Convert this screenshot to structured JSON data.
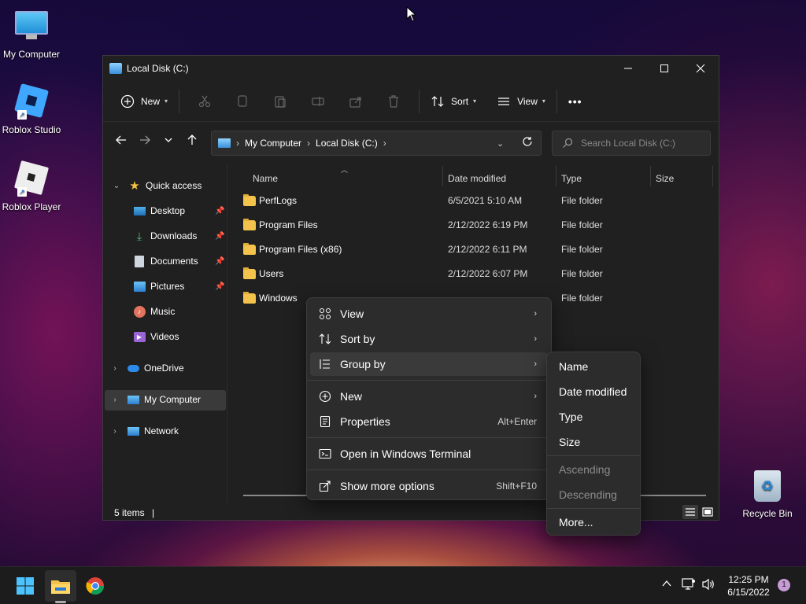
{
  "desktop": {
    "icons": [
      {
        "label": "My Computer"
      },
      {
        "label": "Roblox Studio"
      },
      {
        "label": "Roblox Player"
      },
      {
        "label": "Recycle Bin"
      }
    ]
  },
  "window": {
    "title": "Local Disk (C:)",
    "toolbar": {
      "new_label": "New",
      "sort_label": "Sort",
      "view_label": "View",
      "more_label": "•••"
    },
    "address": {
      "crumbs": [
        "My Computer",
        "Local Disk (C:)"
      ]
    },
    "search": {
      "placeholder": "Search Local Disk (C:)"
    },
    "sidebar": {
      "quick_access": "Quick access",
      "items": [
        {
          "label": "Desktop"
        },
        {
          "label": "Downloads"
        },
        {
          "label": "Documents"
        },
        {
          "label": "Pictures"
        },
        {
          "label": "Music"
        },
        {
          "label": "Videos"
        }
      ],
      "onedrive": "OneDrive",
      "my_computer": "My Computer",
      "network": "Network"
    },
    "columns": {
      "name": "Name",
      "date": "Date modified",
      "type": "Type",
      "size": "Size"
    },
    "files": [
      {
        "name": "PerfLogs",
        "date": "6/5/2021 5:10 AM",
        "type": "File folder"
      },
      {
        "name": "Program Files",
        "date": "2/12/2022 6:19 PM",
        "type": "File folder"
      },
      {
        "name": "Program Files (x86)",
        "date": "2/12/2022 6:11 PM",
        "type": "File folder"
      },
      {
        "name": "Users",
        "date": "2/12/2022 6:07 PM",
        "type": "File folder"
      },
      {
        "name": "Windows",
        "date": "",
        "type": "File folder"
      }
    ],
    "status": "5 items"
  },
  "context_menu": {
    "items": [
      {
        "label": "View"
      },
      {
        "label": "Sort by"
      },
      {
        "label": "Group by"
      },
      {
        "label": "New"
      },
      {
        "label": "Properties",
        "shortcut": "Alt+Enter"
      },
      {
        "label": "Open in Windows Terminal"
      },
      {
        "label": "Show more options",
        "shortcut": "Shift+F10"
      }
    ]
  },
  "submenu": {
    "items": [
      {
        "label": "Name"
      },
      {
        "label": "Date modified"
      },
      {
        "label": "Type"
      },
      {
        "label": "Size"
      },
      {
        "label": "Ascending"
      },
      {
        "label": "Descending"
      },
      {
        "label": "More..."
      }
    ]
  },
  "taskbar": {
    "time": "12:25 PM",
    "date": "6/15/2022",
    "notification_count": "1"
  }
}
